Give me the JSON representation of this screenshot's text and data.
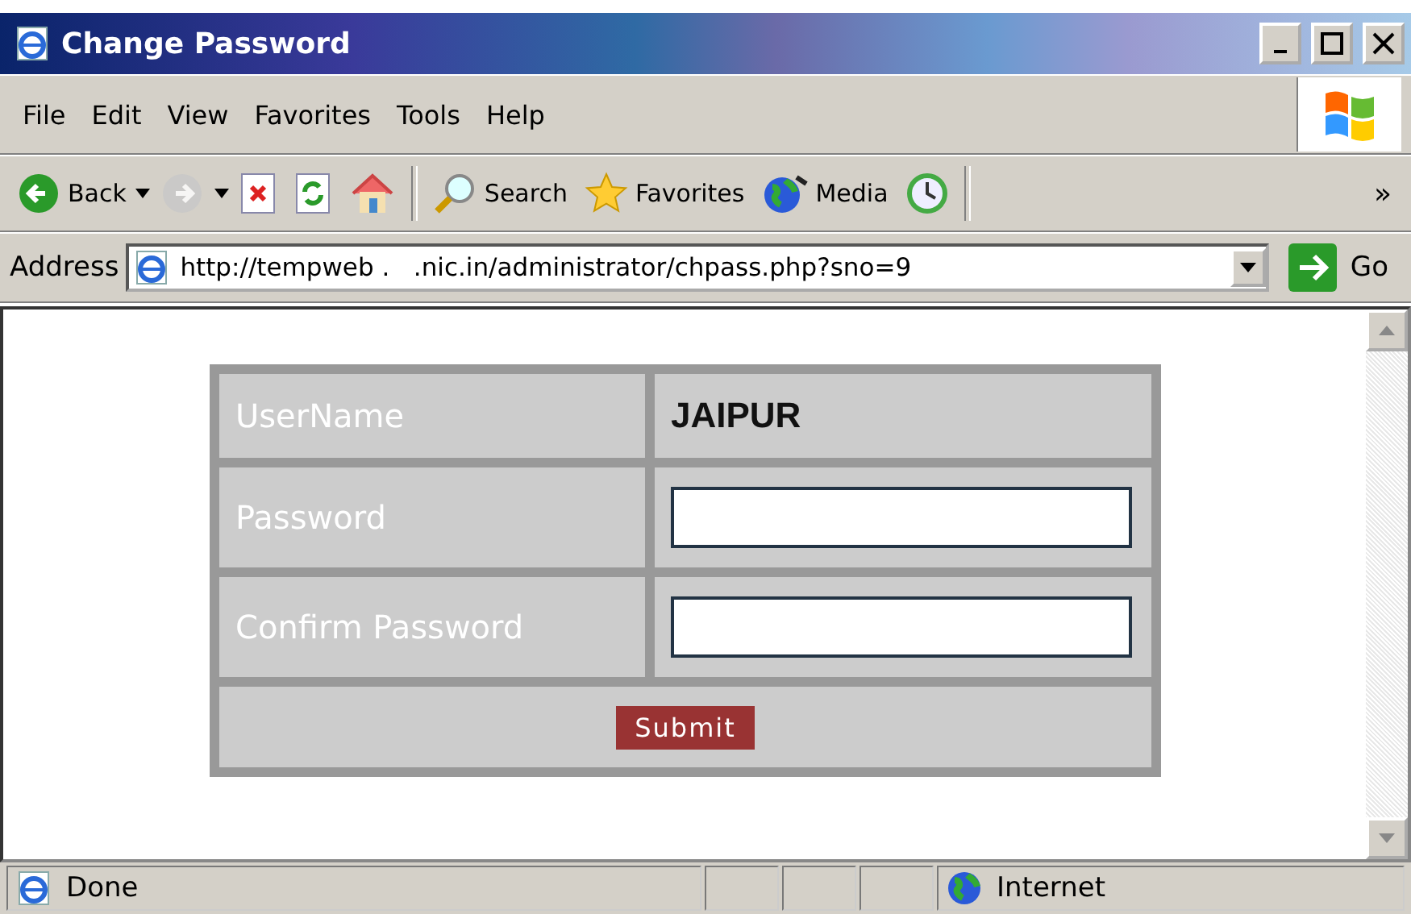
{
  "window": {
    "title": "Change Password"
  },
  "menu": [
    "File",
    "Edit",
    "View",
    "Favorites",
    "Tools",
    "Help"
  ],
  "toolbar": [
    {
      "kind": "back",
      "label": "Back",
      "disabled": false
    },
    {
      "kind": "forward",
      "disabled": true
    },
    {
      "kind": "stop"
    },
    {
      "kind": "refresh"
    },
    {
      "kind": "home"
    },
    {
      "kind": "separator"
    },
    {
      "kind": "search",
      "label": "Search"
    },
    {
      "kind": "favorites",
      "label": "Favorites"
    },
    {
      "kind": "media",
      "label": "Media"
    },
    {
      "kind": "history"
    },
    {
      "kind": "separator"
    }
  ],
  "toolbar_more": "»",
  "address": {
    "label": "Address",
    "url": "http://tempweb .   .nic.in/administrator/chpass.php?sno=9",
    "go": "Go"
  },
  "form": {
    "rows": [
      {
        "kind": "text",
        "label": "UserName",
        "value": "JAIPUR"
      },
      {
        "kind": "password",
        "label": "Password"
      },
      {
        "kind": "password",
        "label": "Confirm Password"
      }
    ],
    "submit": "Submit"
  },
  "status_bar": {
    "text": "Done",
    "zone": "Internet"
  }
}
